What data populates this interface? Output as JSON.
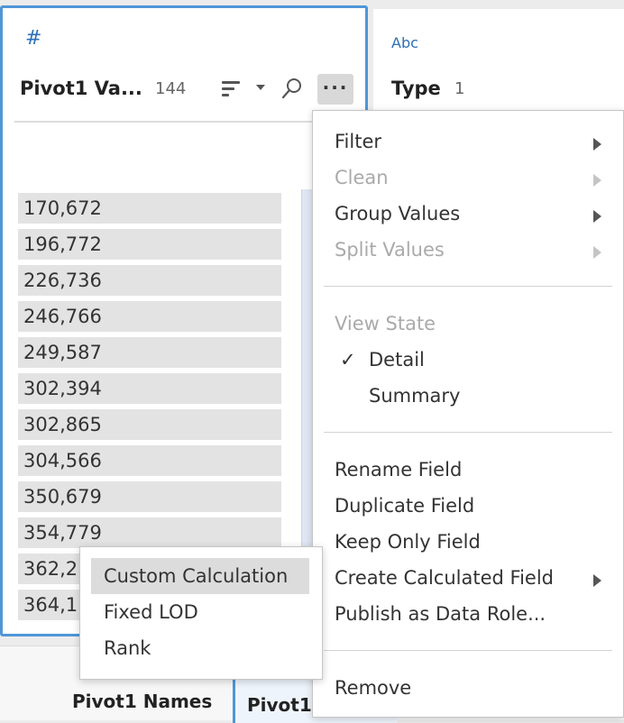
{
  "profile_card": {
    "type_icon": "#",
    "field_name": "Pivot1 Va...",
    "count": "144",
    "more_label": "···",
    "values": [
      "170,672",
      "196,772",
      "226,736",
      "246,766",
      "249,587",
      "302,394",
      "302,865",
      "304,566",
      "350,679",
      "354,779",
      "362,2",
      "364,1"
    ]
  },
  "type_card": {
    "type_icon": "Abc",
    "field_name": "Type",
    "count": "1"
  },
  "bottom": {
    "tab1": "Pivot1 Names",
    "tab2": "Pivot1"
  },
  "menu": {
    "filter": "Filter",
    "clean": "Clean",
    "group_values": "Group Values",
    "split_values": "Split Values",
    "view_state": "View State",
    "check": "✓",
    "detail": "Detail",
    "summary": "Summary",
    "rename_field": "Rename Field",
    "duplicate_field": "Duplicate Field",
    "keep_only_field": "Keep Only Field",
    "create_calculated_field": "Create Calculated Field",
    "publish_as_data_role": "Publish as Data Role...",
    "remove": "Remove"
  },
  "submenu": {
    "items": [
      "Custom Calculation",
      "Fixed LOD",
      "Rank"
    ]
  },
  "icons": {
    "type_number": "hash-icon",
    "type_string": "abc-icon",
    "sort": "sort-icon",
    "search": "search-icon",
    "more": "more-options-icon",
    "submenu_arrow": "chevron-right-icon",
    "check": "checkmark-icon"
  },
  "colors": {
    "accent": "#4f96d8",
    "icon_blue": "#2d6fb6",
    "highlight": "#dcdcdc",
    "disabled_text": "#aaaaaa"
  }
}
